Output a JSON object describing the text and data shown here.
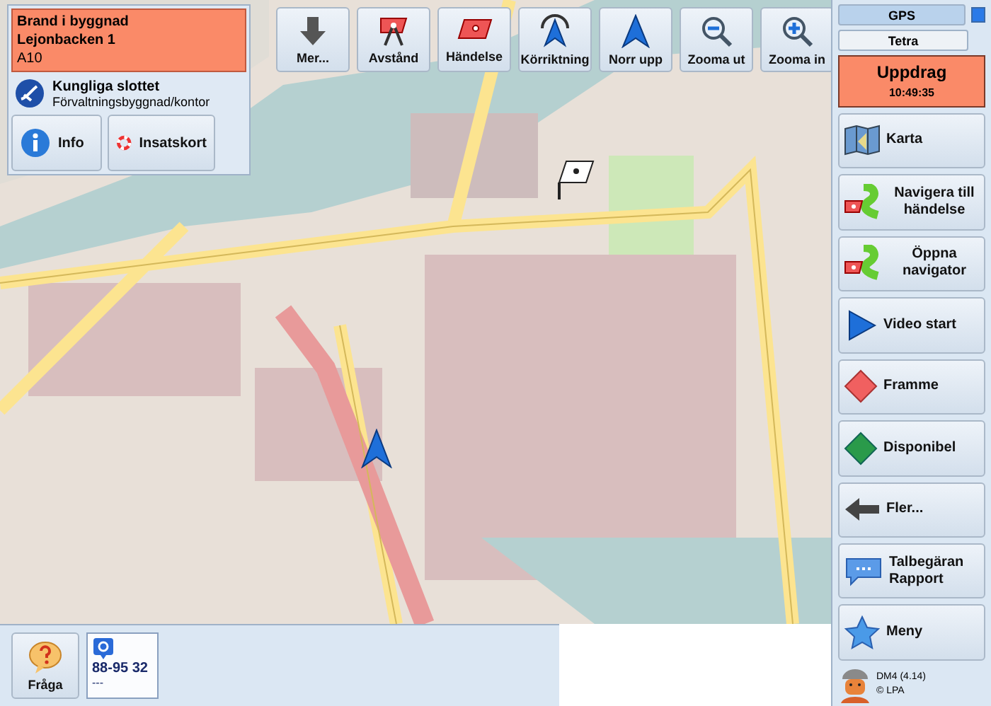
{
  "incident": {
    "type": "Brand i byggnad",
    "address": "Lejonbacken 1",
    "code": "A10",
    "object_name": "Kungliga slottet",
    "object_type": "Förvaltningsbyggnad/kontor",
    "buttons": [
      "Info",
      "Insatskort"
    ]
  },
  "toolbar": [
    "Mer...",
    "Avstånd",
    "Händelse",
    "Körriktning",
    "Norr upp",
    "Zooma ut",
    "Zooma in"
  ],
  "status": {
    "gps": {
      "label": "GPS",
      "on": true
    },
    "tetra": "Tetra"
  },
  "mission": {
    "title": "Uppdrag",
    "time": "10:49:35"
  },
  "side_buttons": [
    "Karta",
    "Navigera till händelse",
    "Öppna navigator",
    "Video start",
    "Framme",
    "Disponibel",
    "Fler...",
    "Talbegäran Rapport",
    "Meny"
  ],
  "footer": {
    "version": "DM4 (4.14)",
    "copyright": "© LPA"
  },
  "bottom": {
    "ask": "Fråga",
    "unit": {
      "number": "88-95 32",
      "status": "---"
    }
  }
}
